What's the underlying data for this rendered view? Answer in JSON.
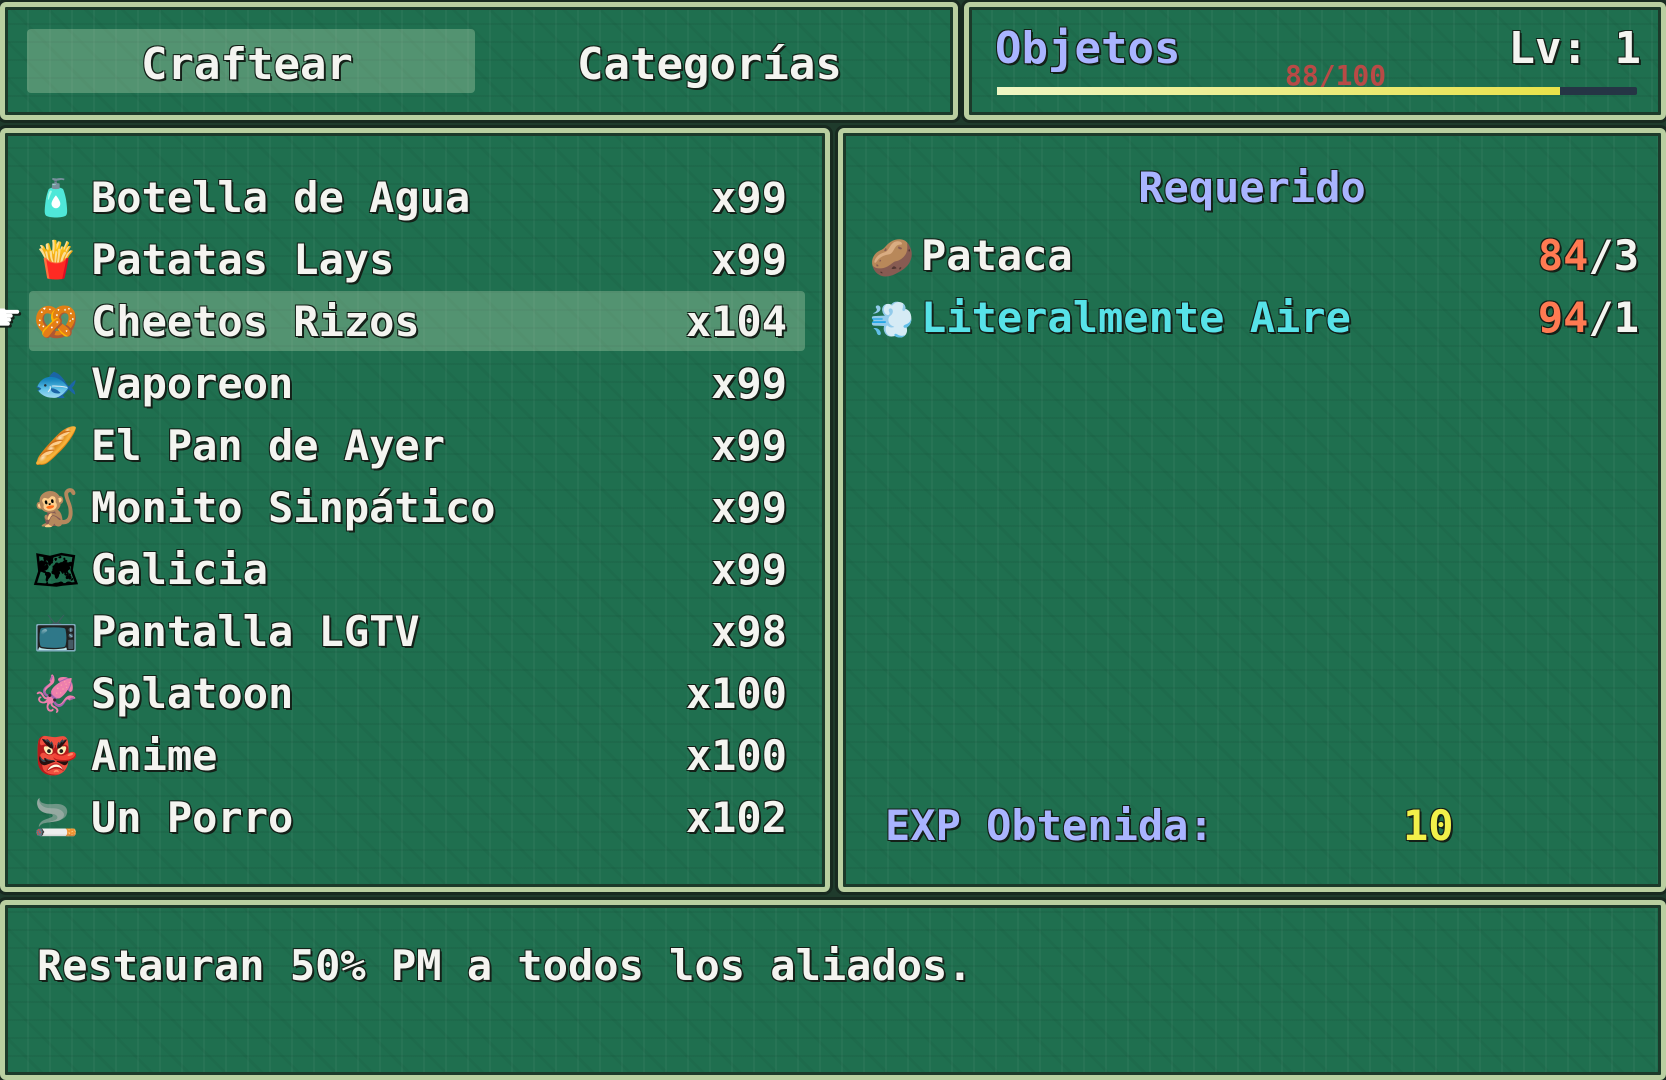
{
  "command_window": {
    "commands": [
      {
        "label": "Craftear",
        "selected": true
      },
      {
        "label": "Categorías",
        "selected": false
      }
    ]
  },
  "status_window": {
    "title": "Objetos",
    "gauge_text": "88/100",
    "gauge_fraction": 0.88,
    "level_text": "Lv: 1"
  },
  "item_list": {
    "items": [
      {
        "name": "Botella de Agua",
        "count": "x99",
        "icon": "water-bottle-icon",
        "glyph": "🧴"
      },
      {
        "name": "Patatas Lays",
        "count": "x99",
        "icon": "chips-bag-icon",
        "glyph": "🍟"
      },
      {
        "name": "Cheetos Rizos",
        "count": "x104",
        "icon": "snack-bag-icon",
        "glyph": "🥨"
      },
      {
        "name": "Vaporeon",
        "count": "x99",
        "icon": "vaporeon-icon",
        "glyph": "🐟"
      },
      {
        "name": "El Pan de Ayer",
        "count": "x99",
        "icon": "bread-icon",
        "glyph": "🥖"
      },
      {
        "name": "Monito Sinpático",
        "count": "x99",
        "icon": "monkey-icon",
        "glyph": "🐒"
      },
      {
        "name": "Galicia",
        "count": "x99",
        "icon": "galicia-map-icon",
        "glyph": "🗺"
      },
      {
        "name": "Pantalla LGTV",
        "count": "x98",
        "icon": "tv-screen-icon",
        "glyph": "📺"
      },
      {
        "name": "Splatoon",
        "count": "x100",
        "icon": "splatoon-icon",
        "glyph": "🦑"
      },
      {
        "name": "Anime",
        "count": "x100",
        "icon": "anime-icon",
        "glyph": "👺"
      },
      {
        "name": "Un Porro",
        "count": "x102",
        "icon": "joint-icon",
        "glyph": "🚬"
      }
    ],
    "selected_index": 2
  },
  "requirements": {
    "title": "Requerido",
    "materials": [
      {
        "name": "Pataca",
        "have": "84",
        "need": "/3",
        "icon": "potato-icon",
        "glyph": "🥔"
      },
      {
        "name": "Literalmente Aire",
        "have": "94",
        "need": "/1",
        "icon": "air-icon",
        "glyph": "💨"
      }
    ],
    "exp_label": "EXP Obtenida:",
    "exp_value": "10"
  },
  "help": {
    "text": "Restauran 50% PM a todos los aliados."
  },
  "cursor": {
    "icon": "hand-pointer-icon",
    "glyph": "☛"
  },
  "colors": {
    "window": "#1f6f4f",
    "system_text": "#a9b4ff",
    "have_count": "#ff7a52",
    "special_item": "#57e2e8",
    "exp_value": "#f2f04a"
  }
}
